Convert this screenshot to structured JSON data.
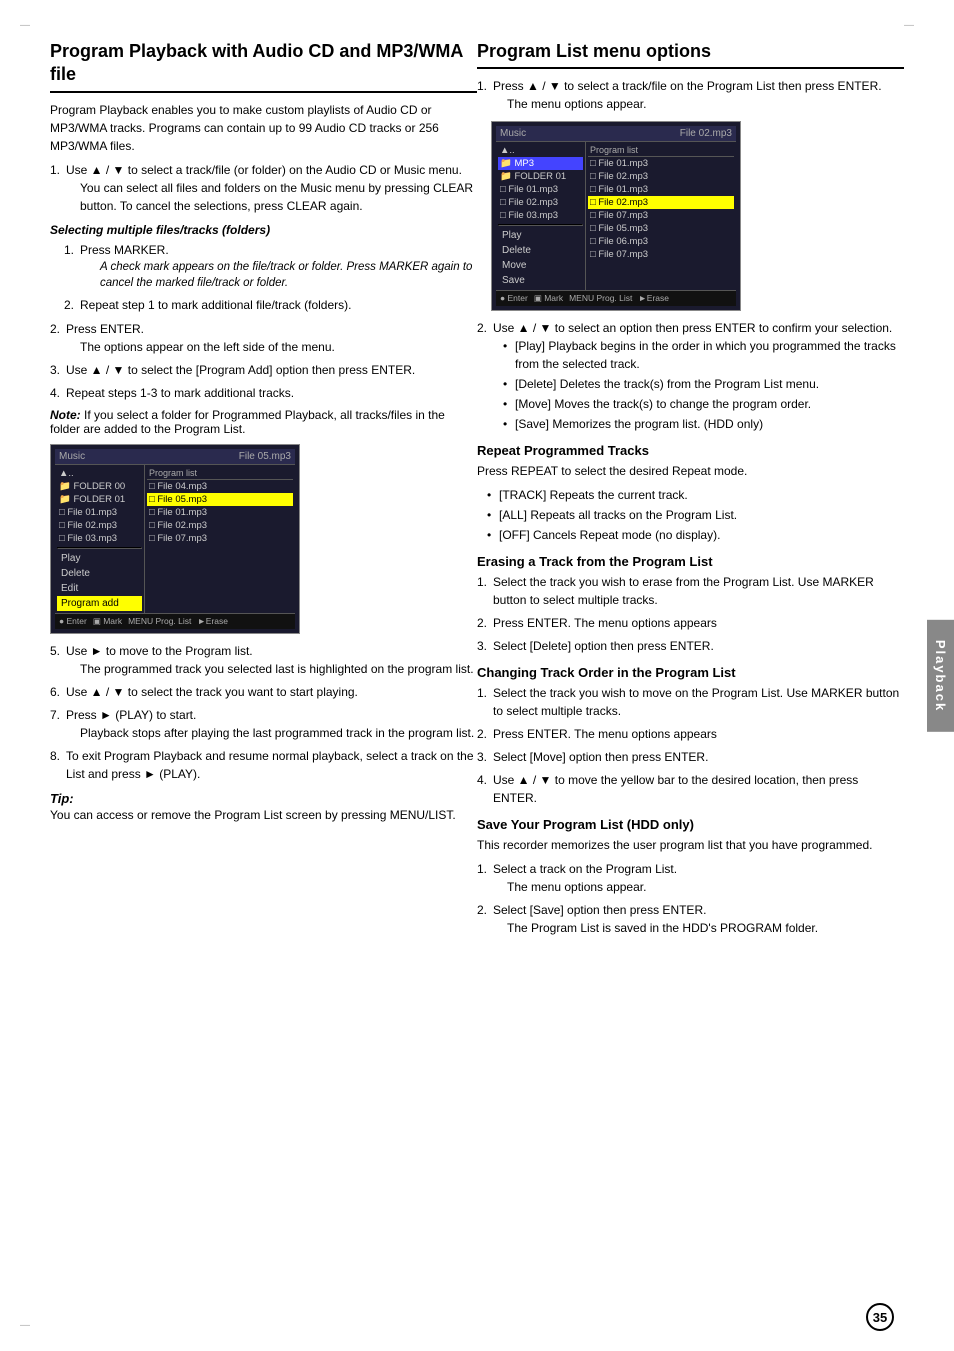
{
  "page": {
    "number": "35",
    "side_tab": "Playback"
  },
  "left_section": {
    "title": "Program Playback with Audio CD and MP3/WMA file",
    "intro": "Program Playback enables you to make custom playlists of Audio CD or MP3/WMA tracks. Programs can contain up to 99 Audio CD tracks or 256 MP3/WMA files.",
    "step1": "Use ▲ / ▼ to select a track/file (or folder) on the Audio CD or Music menu.",
    "step1_sub": "You can select all files and folders on the Music menu by pressing CLEAR button. To cancel the selections, press CLEAR again.",
    "selecting_heading": "Selecting multiple files/tracks (folders)",
    "sublist_1_num": "1.",
    "sublist_1_text": "Press MARKER.",
    "sublist_1_italic": "A check mark appears on the file/track or folder. Press MARKER again to cancel the marked file/track or folder.",
    "sublist_2_num": "2.",
    "sublist_2_text": "Repeat step 1 to mark additional file/track (folders).",
    "step2": "Press ENTER.",
    "step2_sub": "The options appear on the left side of the menu.",
    "step3": "Use ▲ / ▼ to select the [Program Add] option then press ENTER.",
    "step4": "Repeat steps 1-3 to mark additional tracks.",
    "note_label": "Note:",
    "note_text": "If you select a folder for Programmed Playback, all tracks/files in the folder are added to the Program List.",
    "step5": "Use ► to move to the Program list.",
    "step5_sub": "The programmed track you selected last is highlighted on the program list.",
    "step6": "Use ▲ / ▼ to select the track you want to start playing.",
    "step7": "Press ► (PLAY) to start.",
    "step7_sub": "Playback stops after playing the last programmed track in the program list.",
    "step8": "To exit Program Playback and resume normal playback, select a track on the List and press ► (PLAY).",
    "tip_label": "Tip:",
    "tip_text": "You can access or remove the Program List screen by pressing MENU/LIST."
  },
  "right_section": {
    "title": "Program List menu options",
    "step1": "Press ▲ / ▼ to select a track/file on the Program List then press ENTER.",
    "step1_sub": "The menu options appear.",
    "step2": "Use ▲ / ▼ to select an option then press ENTER to confirm your selection.",
    "bullet_play": "[Play] Playback begins in the order in which you programmed the tracks from the selected track.",
    "bullet_delete": "[Delete] Deletes the track(s) from the Program List menu.",
    "bullet_move": "[Move] Moves the track(s) to change the program order.",
    "bullet_save": "[Save] Memorizes the program list. (HDD only)",
    "repeat_title": "Repeat Programmed Tracks",
    "repeat_intro": "Press REPEAT to select the desired Repeat mode.",
    "repeat_track": "[TRACK] Repeats the current track.",
    "repeat_all": "[ALL] Repeats all tracks on the Program List.",
    "repeat_off": "[OFF] Cancels Repeat mode (no display).",
    "erase_title": "Erasing a Track from the Program List",
    "erase_1": "Select the track you wish to erase from the Program List. Use MARKER button to select multiple tracks.",
    "erase_2": "Press ENTER. The menu options appears",
    "erase_3": "Select [Delete] option then press ENTER.",
    "change_title": "Changing Track Order in the Program List",
    "change_1": "Select the track you wish to move on the Program List. Use MARKER button to select multiple tracks.",
    "change_2": "Press ENTER. The menu options appears",
    "change_3": "Select [Move] option then press ENTER.",
    "change_4": "Use ▲ / ▼ to move the yellow bar to the desired location, then press ENTER.",
    "save_title": "Save Your Program List (HDD only)",
    "save_intro": "This recorder memorizes the user program list that you have programmed.",
    "save_1": "Select a track on the Program List.",
    "save_1_sub": "The menu options appear.",
    "save_2": "Select [Save] option then press ENTER.",
    "save_2_sub": "The Program List is saved in the HDD's PROGRAM folder."
  },
  "screenshot1": {
    "header_left": "Music",
    "header_file": "File 05.mp3",
    "left_col_header": "",
    "right_col_header": "Program list",
    "folders": [
      {
        "name": "▲..",
        "type": "up"
      },
      {
        "name": "FOLDER 00",
        "type": "folder"
      },
      {
        "name": "FOLDER 01",
        "type": "folder"
      },
      {
        "name": "File 01.mp3",
        "type": "file"
      },
      {
        "name": "File 02.mp3",
        "type": "file"
      },
      {
        "name": "File 03.mp3",
        "type": "file"
      }
    ],
    "program_files": [
      {
        "name": "File 04.mp3",
        "selected": false
      },
      {
        "name": "File 05.mp3",
        "selected": false
      },
      {
        "name": "File 01.mp3",
        "selected": false
      },
      {
        "name": "File 02.mp3",
        "selected": false
      },
      {
        "name": "File 07.mp3",
        "selected": false
      }
    ],
    "menu_items": [
      "Play",
      "Delete",
      "Edit",
      "Program add"
    ],
    "active_menu": "Program add",
    "active_file": "File 05.mp3",
    "footer": "Enter: ENTER Mark: MENU Prog. List: ►Erase"
  },
  "screenshot2": {
    "header_left": "Music",
    "header_file": "File 02.mp3",
    "right_col_header": "Program list",
    "folders": [
      {
        "name": "▲..",
        "type": "up"
      },
      {
        "name": "MP3",
        "type": "folder",
        "active": true
      },
      {
        "name": "FOLDER 01",
        "type": "folder"
      },
      {
        "name": "File 01.mp3",
        "type": "file"
      },
      {
        "name": "File 02.mp3",
        "type": "file"
      },
      {
        "name": "File 03.mp3",
        "type": "file"
      }
    ],
    "program_files": [
      {
        "name": "File 01.mp3",
        "selected": false
      },
      {
        "name": "File 02.mp3",
        "selected": false
      },
      {
        "name": "File 01.mp3",
        "selected": false
      },
      {
        "name": "File 02.mp3",
        "selected": false
      },
      {
        "name": "File 07.mp3",
        "selected": false
      },
      {
        "name": "File 05.mp3",
        "selected": false
      },
      {
        "name": "File 06.mp3",
        "selected": false
      },
      {
        "name": "File 07.mp3",
        "selected": false
      }
    ],
    "menu_items": [
      "Play",
      "Delete",
      "Move",
      "Save"
    ],
    "active_menu": "",
    "active_file": "File 02.mp3",
    "footer": "Enter: ENTER Mark: MENU Prog. List: ►Erase"
  }
}
